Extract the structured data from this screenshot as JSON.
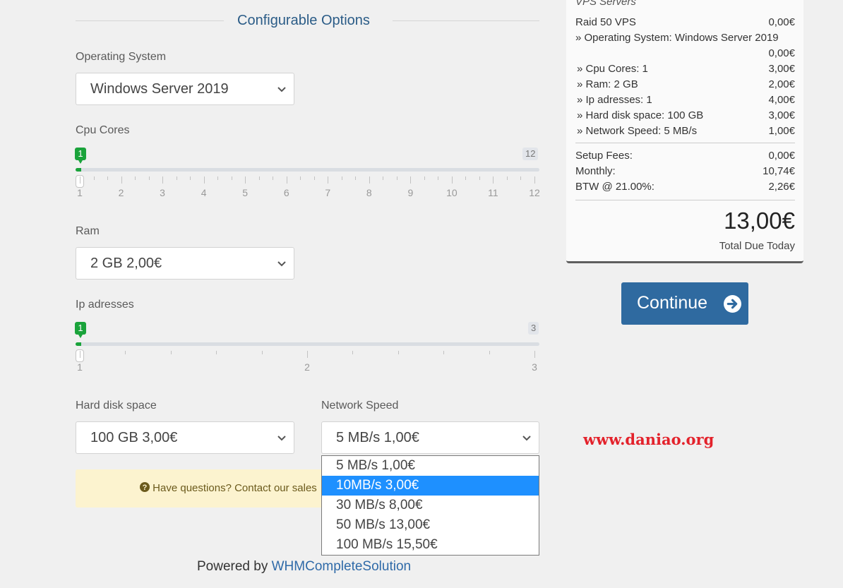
{
  "section_title": "Configurable Options",
  "os": {
    "label": "Operating System",
    "value": "Windows Server 2019"
  },
  "cpu": {
    "label": "Cpu Cores",
    "min_badge": "1",
    "max_badge": "12",
    "ticks": [
      "1",
      "2",
      "3",
      "4",
      "5",
      "6",
      "7",
      "8",
      "9",
      "10",
      "11",
      "12"
    ]
  },
  "ram": {
    "label": "Ram",
    "value": "2 GB 2,00€"
  },
  "ip": {
    "label": "Ip adresses",
    "min_badge": "1",
    "max_badge": "3",
    "ticks": [
      "1",
      "2",
      "3"
    ]
  },
  "disk": {
    "label": "Hard disk space",
    "value": "100 GB 3,00€"
  },
  "network": {
    "label": "Network Speed",
    "value": "5 MB/s 1,00€",
    "options": [
      "5 MB/s 1,00€",
      "10MB/s 3,00€",
      "30 MB/s 8,00€",
      "50 MB/s 13,00€",
      "100 MB/s 15,50€"
    ],
    "highlighted_index": 1
  },
  "help_text": "Have questions? Contact our sales",
  "powered_by": {
    "prefix": "Powered by",
    "link": "WHMCompleteSolution"
  },
  "summary": {
    "group": "VPS Servers",
    "product": {
      "name": "Raid 50 VPS",
      "price": "0,00€"
    },
    "os_line": "» Operating System: Windows Server 2019",
    "os_price": "0,00€",
    "options": [
      {
        "name": "» Cpu Cores: 1",
        "price": "3,00€"
      },
      {
        "name": "» Ram: 2 GB",
        "price": "2,00€"
      },
      {
        "name": "» Ip adresses: 1",
        "price": "4,00€"
      },
      {
        "name": "» Hard disk space: 100 GB",
        "price": "3,00€"
      },
      {
        "name": "» Network Speed: 5 MB/s",
        "price": "1,00€"
      }
    ],
    "setup_label": "Setup Fees:",
    "setup_value": "0,00€",
    "monthly_label": "Monthly:",
    "monthly_value": "10,74€",
    "tax_label": "BTW @ 21.00%:",
    "tax_value": "2,26€",
    "total": "13,00€",
    "total_label": "Total Due Today"
  },
  "continue_label": "Continue",
  "watermark": "www.daniao.org",
  "colors": {
    "accent": "#2f6aa0",
    "slider_green": "#1aa33b",
    "highlight": "#1e90ff",
    "watermark": "#e3222b"
  }
}
